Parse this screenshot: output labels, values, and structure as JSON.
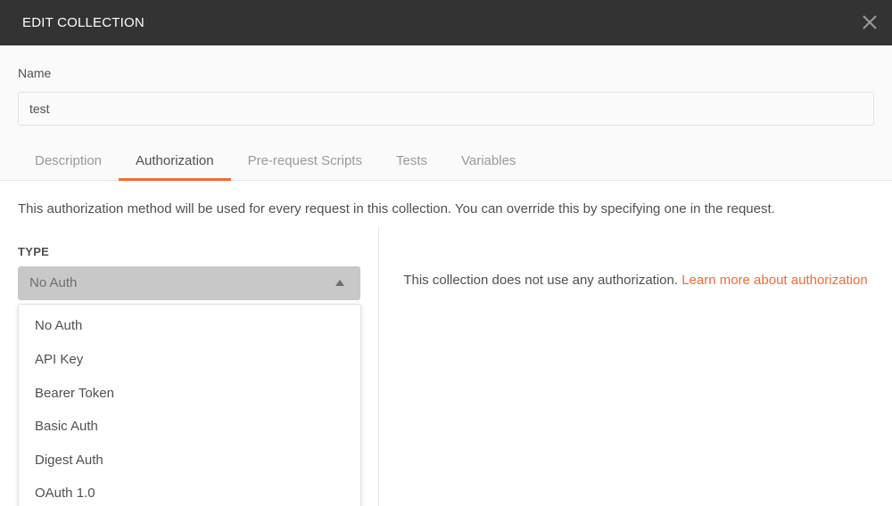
{
  "dialog": {
    "title": "EDIT COLLECTION",
    "close_icon": "close-icon"
  },
  "name": {
    "label": "Name",
    "value": "test"
  },
  "tabs": [
    {
      "label": "Description",
      "active": false
    },
    {
      "label": "Authorization",
      "active": true
    },
    {
      "label": "Pre-request Scripts",
      "active": false
    },
    {
      "label": "Tests",
      "active": false
    },
    {
      "label": "Variables",
      "active": false
    }
  ],
  "authorization": {
    "description": "This authorization method will be used for every request in this collection. You can override this by specifying one in the request.",
    "type_label": "TYPE",
    "selected": "No Auth",
    "options": [
      "No Auth",
      "API Key",
      "Bearer Token",
      "Basic Auth",
      "Digest Auth",
      "OAuth 1.0"
    ],
    "info_text": "This collection does not use any authorization.",
    "learn_more_link": "Learn more about authorization"
  },
  "colors": {
    "accent": "#f26b3a",
    "titlebar": "#333333"
  }
}
